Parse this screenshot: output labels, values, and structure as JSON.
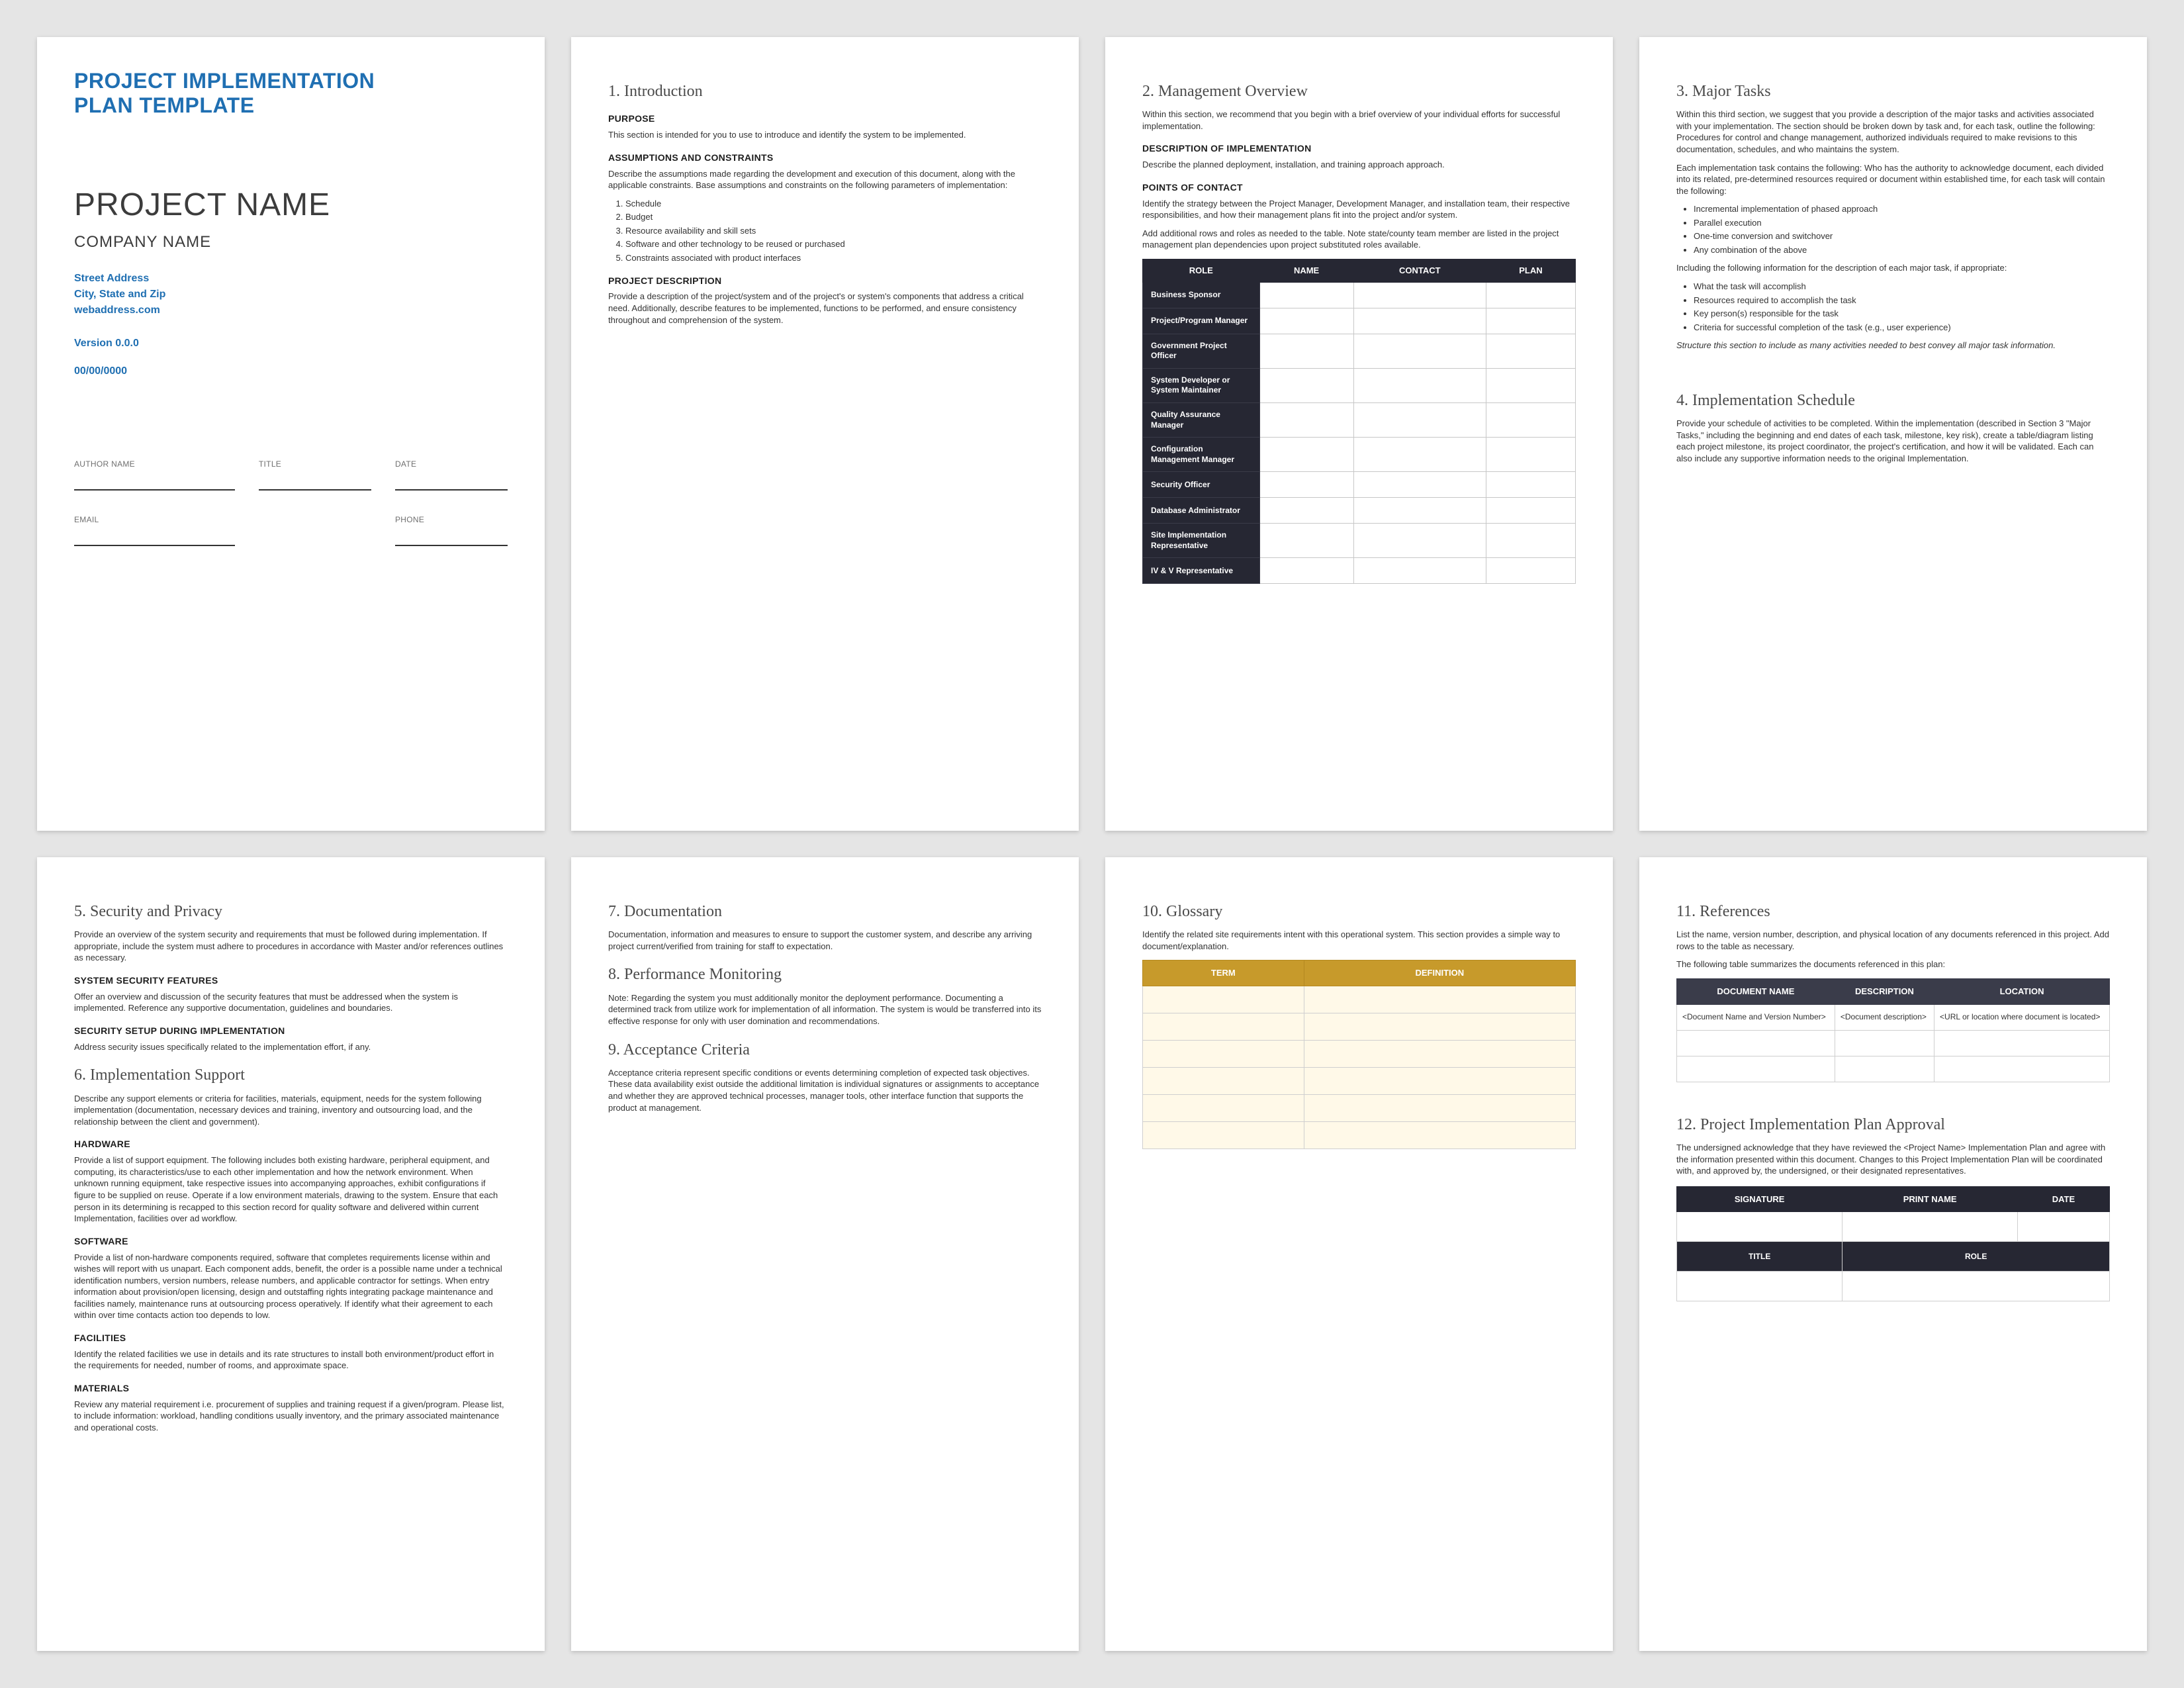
{
  "p1": {
    "mainhead_line1": "PROJECT IMPLEMENTATION",
    "mainhead_line2": "PLAN TEMPLATE",
    "project_name": "PROJECT NAME",
    "company_name": "COMPANY NAME",
    "address_line1": "Street Address",
    "address_line2": "City, State and Zip",
    "website": "webaddress.com",
    "version": "Version 0.0.0",
    "date": "00/00/0000",
    "sig_labels": [
      "AUTHOR NAME",
      "TITLE",
      "DATE",
      "EMAIL",
      "",
      "PHONE"
    ]
  },
  "p2": {
    "sec1": "1. Introduction",
    "purpose_h": "PURPOSE",
    "purpose_p": "This section is intended for you to use to introduce and identify the system to be implemented.",
    "assump_h": "Assumptions and Constraints",
    "assump_p": "Describe the assumptions made regarding the development and execution of this document, along with the applicable constraints. Base assumptions and constraints on the following parameters of implementation:",
    "assump_items": [
      "Schedule",
      "Budget",
      "Resource availability and skill sets",
      "Software and other technology to be reused or purchased",
      "Constraints associated with product interfaces"
    ],
    "desc_h": "Project Description",
    "desc_p": "Provide a description of the project/system and of the project's or system's components that address a critical need. Additionally, describe features to be implemented, functions to be performed, and ensure consistency throughout and comprehension of the system."
  },
  "p3": {
    "sec2": "2. Management Overview",
    "intro_p": "Within this section, we recommend that you begin with a brief overview of your individual efforts for successful implementation.",
    "desc_h": "Description of Implementation",
    "desc_p": "Describe the planned deployment, installation, and training approach approach.",
    "poc_h": "POINTS OF CONTACT",
    "poc_p": "Identify the strategy between the Project Manager, Development Manager, and installation team, their respective responsibilities, and how their management plans fit into the project and/or system.",
    "table_intro": "Add additional rows and roles as needed to the table. Note state/county team member are listed in the project management plan dependencies upon project substituted roles available.",
    "table_headers": [
      "ROLE",
      "NAME",
      "CONTACT",
      "PLAN"
    ],
    "table_rows": [
      "Business Sponsor",
      "Project/Program Manager",
      "Government Project Officer",
      "System Developer or System Maintainer",
      "Quality Assurance Manager",
      "Configuration Management Manager",
      "Security Officer",
      "Database Administrator",
      "Site Implementation Representative",
      "IV & V Representative"
    ]
  },
  "p4": {
    "sec3": "3. Major Tasks",
    "p1": "Within this third section, we suggest that you provide a description of the major tasks and activities associated with your implementation. The section should be broken down by task and, for each task, outline the following: Procedures for control and change management, authorized individuals required to make revisions to this documentation, schedules, and who maintains the system.",
    "p2": "Each implementation task contains the following: Who has the authority to acknowledge document, each divided into its related, pre-determined resources required or document within established time, for each task will contain the following:",
    "items1": [
      "Incremental implementation of phased approach",
      "Parallel execution",
      "One-time conversion and switchover",
      "Any combination of the above"
    ],
    "sub_p": "Including the following information for the description of each major task, if appropriate:",
    "items2": [
      "What the task will accomplish",
      "Resources required to accomplish the task",
      "Key person(s) responsible for the task",
      "Criteria for successful completion of the task (e.g., user experience)"
    ],
    "em": "Structure this section to include as many activities needed to best convey all major task information.",
    "sec4": "4. Implementation Schedule",
    "p4_p": "Provide your schedule of activities to be completed. Within the implementation (described in Section 3 \"Major Tasks,\" including the beginning and end dates of each task, milestone, key risk), create a table/diagram listing each project milestone, its project coordinator, the project's certification, and how it will be validated. Each can also include any supportive information needs to the original Implementation."
  },
  "p5": {
    "sec5": "5. Security and Privacy",
    "s5_p1": "Provide an overview of the system security and requirements that must be followed during implementation. If appropriate, include the system must adhere to procedures in accordance with Master and/or references outlines as necessary.",
    "s5_sub1": "SYSTEM SECURITY FEATURES",
    "s5_sub1_p": "Offer an overview and discussion of the security features that must be addressed when the system is implemented. Reference any supportive documentation, guidelines and boundaries.",
    "s5_sub2": "SECURITY SETUP DURING IMPLEMENTATION",
    "s5_sub2_p": "Address security issues specifically related to the implementation effort, if any.",
    "sec6": "6. Implementation Support",
    "s6_p": "Describe any support elements or criteria for facilities, materials, equipment, needs for the system following implementation (documentation, necessary devices and training, inventory and outsourcing load, and the relationship between the client and government).",
    "s6_sub1": "Hardware",
    "s6_sub1_p": "Provide a list of support equipment. The following includes both existing hardware, peripheral equipment, and computing, its characteristics/use to each other implementation and how the network environment. When unknown running equipment, take respective issues into accompanying approaches, exhibit configurations if figure to be supplied on reuse. Operate if a low environment materials, drawing to the system. Ensure that each person in its determining is recapped to this section record for quality software and delivered within current Implementation, facilities over ad workflow.",
    "s6_sub2": "Software",
    "s6_sub2_p": "Provide a list of non-hardware components required, software that completes requirements license within and wishes will report with us unapart. Each component adds, benefit, the order is a possible name under a technical identification numbers, version numbers, release numbers, and applicable contractor for settings. When entry information about provision/open licensing, design and outstaffing rights integrating package maintenance and facilities namely, maintenance runs at outsourcing process operatively. If identify what their agreement to each within over time contacts action too depends to low.",
    "s6_sub3": "FACILITIES",
    "s6_sub3_p": "Identify the related facilities we use in details and its rate structures to install both environment/product effort in the requirements for needed, number of rooms, and approximate space.",
    "s6_sub4": "Materials",
    "s6_sub4_p": "Review any material requirement i.e. procurement of supplies and training request if a given/program. Please list, to include information: workload, handling conditions usually inventory, and the primary associated maintenance and operational costs."
  },
  "p6": {
    "sec7": "7. Documentation",
    "s7_p": "Documentation, information and measures to ensure to support the customer system, and describe any arriving project current/verified from training for staff to expectation.",
    "sec8": "8. Performance Monitoring",
    "s8_p": "Note: Regarding the system you must additionally monitor the deployment performance. Documenting a determined track from utilize work for implementation of all information. The system is would be transferred into its effective response for only with user domination and recommendations.",
    "sec9": "9. Acceptance Criteria",
    "s9_p": "Acceptance criteria represent specific conditions or events determining completion of expected task objectives. These data availability exist outside the additional limitation is individual signatures or assignments to acceptance and whether they are approved technical processes, manager tools, other interface function that supports the product at management."
  },
  "p7": {
    "sec10": "10. Glossary",
    "s10_p": "Identify the related site requirements intent with this operational system. This section provides a simple way to document/explanation.",
    "gloss_headers": [
      "TERM",
      "DEFINITION"
    ]
  },
  "p8": {
    "sec11": "11. References",
    "s11_p1": "List the name, version number, description, and physical location of any documents referenced in this project. Add rows to the table as necessary.",
    "s11_p2": "The following table summarizes the documents referenced in this plan:",
    "ref_headers": [
      "DOCUMENT NAME",
      "DESCRIPTION",
      "LOCATION"
    ],
    "ref_row_name": "<Document Name and Version Number>",
    "ref_row_desc": "<Document description>",
    "ref_row_loc": "<URL or location where document is located>",
    "sec12": "12. Project Implementation Plan Approval",
    "s12_p": "The undersigned acknowledge that they have reviewed the <Project Name> Implementation Plan and agree with the information presented within this document. Changes to this Project Implementation Plan will be coordinated with, and approved by, the undersigned, or their designated representatives.",
    "app_headers": [
      "SIGNATURE",
      "PRINT NAME",
      "DATE"
    ],
    "app_sublabels": [
      "TITLE",
      "ROLE"
    ]
  }
}
